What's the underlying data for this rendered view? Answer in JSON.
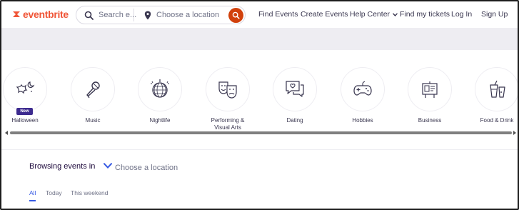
{
  "brand": {
    "name": "eventbrite",
    "color": "#f05537"
  },
  "search": {
    "event_placeholder": "Search e...",
    "location_placeholder": "Choose a location",
    "button_color": "#d1410c"
  },
  "nav": {
    "find_events": "Find Events",
    "create_events": "Create Events",
    "help_center": "Help Center",
    "find_tickets": "Find my tickets",
    "log_in": "Log In",
    "sign_up": "Sign Up"
  },
  "categories": [
    {
      "label": "Halloween",
      "icon": "bat-moon-icon",
      "badge": "New"
    },
    {
      "label": "Music",
      "icon": "microphone-icon"
    },
    {
      "label": "Nightlife",
      "icon": "disco-ball-icon"
    },
    {
      "label": "Performing & Visual Arts",
      "icon": "theater-masks-icon"
    },
    {
      "label": "Dating",
      "icon": "chat-heart-icon"
    },
    {
      "label": "Hobbies",
      "icon": "gamepad-icon"
    },
    {
      "label": "Business",
      "icon": "presentation-board-icon"
    },
    {
      "label": "Food & Drink",
      "icon": "drink-icon"
    }
  ],
  "browsing": {
    "label": "Browsing events in",
    "location": "Choose a location"
  },
  "tabs": [
    {
      "label": "All",
      "active": true
    },
    {
      "label": "Today",
      "active": false
    },
    {
      "label": "This weekend",
      "active": false
    }
  ],
  "colors": {
    "accent_blue": "#3659e3",
    "badge_purple": "#3d2b8f"
  }
}
